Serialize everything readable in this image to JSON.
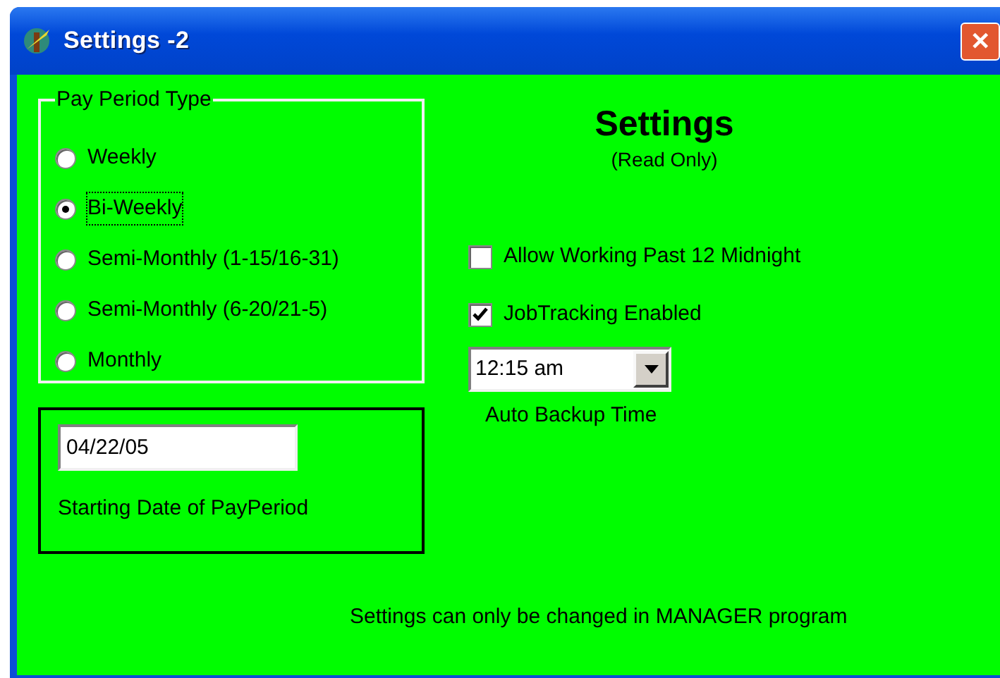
{
  "window": {
    "title": "Settings -2",
    "close_label": "✕"
  },
  "pay_period": {
    "legend": "Pay Period Type",
    "options": [
      {
        "label": "Weekly",
        "selected": false
      },
      {
        "label": "Bi-Weekly",
        "selected": true
      },
      {
        "label": "Semi-Monthly (1-15/16-31)",
        "selected": false
      },
      {
        "label": "Semi-Monthly (6-20/21-5)",
        "selected": false
      },
      {
        "label": "Monthly",
        "selected": false
      }
    ]
  },
  "start_date": {
    "value": "04/22/05",
    "label": "Starting Date of PayPeriod"
  },
  "heading": {
    "title": "Settings",
    "subtitle": "(Read Only)"
  },
  "checkboxes": [
    {
      "label": "Allow Working Past 12 Midnight",
      "checked": false
    },
    {
      "label": "JobTracking Enabled",
      "checked": true
    }
  ],
  "backup": {
    "value": "12:15 am",
    "label": "Auto Backup Time"
  },
  "footer_note": "Settings can only be changed in MANAGER program"
}
